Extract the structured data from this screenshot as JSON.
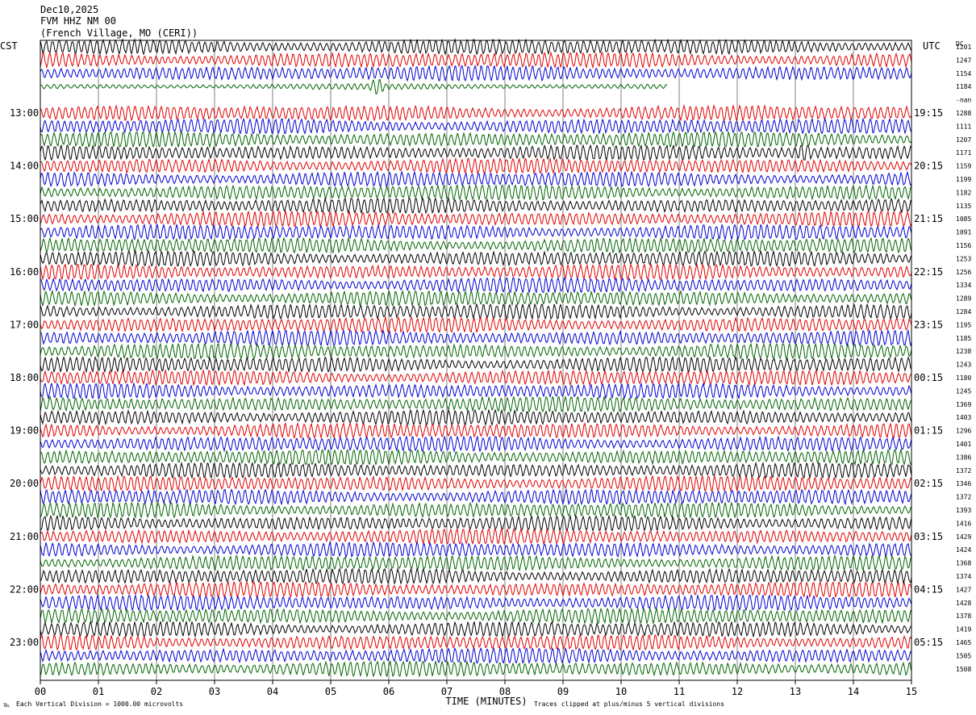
{
  "header": {
    "date": "Dec10,2025",
    "station": "FVM HHZ NM 00",
    "location": "(French Village, MO (CERI))"
  },
  "left_zone": "CST",
  "right_zone": "UTC",
  "dc_header": "DC",
  "footer": {
    "scale": "Each Vertical Division = 1000.00 microvolts",
    "clip": "Traces clipped at plus/minus 5 vertical divisions",
    "mark": "℡"
  },
  "colors": {
    "cycle": [
      "#000000",
      "#e00000",
      "#0000d0",
      "#006400"
    ],
    "grid": "#808080",
    "frame": "#000000"
  },
  "chart_data": {
    "type": "line",
    "title": "",
    "xlabel": "TIME (MINUTES)",
    "ylabel": "",
    "xlim": [
      0,
      15
    ],
    "x_ticks": [
      "00",
      "01",
      "02",
      "03",
      "04",
      "05",
      "06",
      "07",
      "08",
      "09",
      "10",
      "11",
      "12",
      "13",
      "14",
      "15"
    ],
    "grid": true,
    "trace_count": 48,
    "trace_minutes": 15,
    "left_labels": [
      {
        "row": 5,
        "text": "13:00"
      },
      {
        "row": 9,
        "text": "14:00"
      },
      {
        "row": 13,
        "text": "15:00"
      },
      {
        "row": 17,
        "text": "16:00"
      },
      {
        "row": 21,
        "text": "17:00"
      },
      {
        "row": 25,
        "text": "18:00"
      },
      {
        "row": 29,
        "text": "19:00"
      },
      {
        "row": 33,
        "text": "20:00"
      },
      {
        "row": 37,
        "text": "21:00"
      },
      {
        "row": 41,
        "text": "22:00"
      },
      {
        "row": 45,
        "text": "23:00"
      }
    ],
    "right_labels": [
      {
        "row": 5,
        "text": "19:15"
      },
      {
        "row": 9,
        "text": "20:15"
      },
      {
        "row": 13,
        "text": "21:15"
      },
      {
        "row": 17,
        "text": "22:15"
      },
      {
        "row": 21,
        "text": "23:15"
      },
      {
        "row": 25,
        "text": "00:15"
      },
      {
        "row": 29,
        "text": "01:15"
      },
      {
        "row": 33,
        "text": "02:15"
      },
      {
        "row": 37,
        "text": "03:15"
      },
      {
        "row": 41,
        "text": "04:15"
      },
      {
        "row": 45,
        "text": "05:15"
      }
    ],
    "dc_offsets": [
      "1201",
      "1247",
      "1154",
      "1184",
      "-nan",
      "1288",
      "1111",
      "1207",
      "1171",
      "1159",
      "1199",
      "1182",
      "1135",
      "1085",
      "1091",
      "1156",
      "1253",
      "1256",
      "1334",
      "1289",
      "1284",
      "1195",
      "1185",
      "1238",
      "1243",
      "1180",
      "1245",
      "1369",
      "1403",
      "1296",
      "1401",
      "1386",
      "1372",
      "1346",
      "1372",
      "1393",
      "1416",
      "1429",
      "1424",
      "1368",
      "1374",
      "1427",
      "1428",
      "1378",
      "1419",
      "1465",
      "1505",
      "1508"
    ],
    "gaps": [
      {
        "row": 3,
        "from_minute": 10.8,
        "to_minute": 15
      },
      {
        "row": 4,
        "from_minute": 0,
        "to_minute": 15
      }
    ],
    "events": [
      {
        "row": 8,
        "minute": 13.15,
        "label": ""
      },
      {
        "row": 3,
        "minute": 5.8,
        "label": ""
      }
    ]
  }
}
